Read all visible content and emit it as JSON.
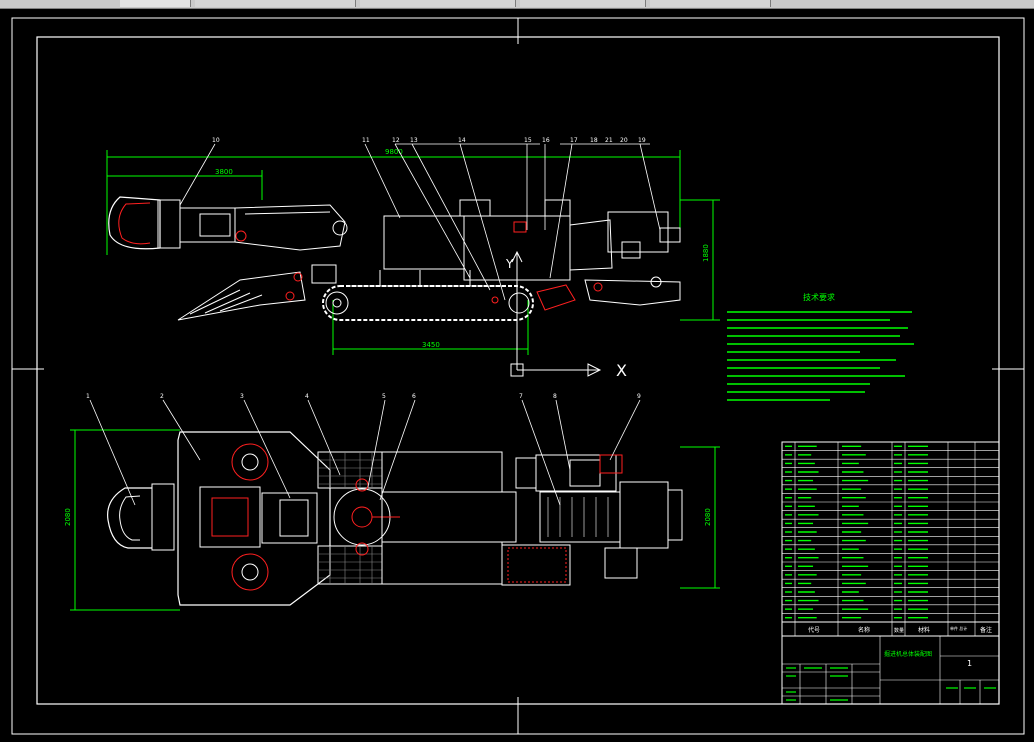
{
  "colors": {
    "background": "#000000",
    "line": "#ffffff",
    "dimension": "#00ff00",
    "highlight": "#ff2020",
    "text_green": "#00ff00"
  },
  "dimensions": {
    "overall_length": "9800",
    "boom_length": "3800",
    "track_length": "3450",
    "height": "1880",
    "plan_width_left": "2080",
    "plan_width_right": "2080"
  },
  "axis": {
    "x_label": "X",
    "y_label": "Y"
  },
  "side_balloons": [
    "10",
    "11",
    "12",
    "13",
    "14",
    "15",
    "16",
    "17",
    "18",
    "21",
    "20",
    "19"
  ],
  "plan_balloons": [
    "1",
    "2",
    "3",
    "4",
    "5",
    "6",
    "7",
    "8",
    "9"
  ],
  "tech_requirements": {
    "title": "技术要求"
  },
  "title_block": {
    "drawing_title": "掘进机总体装配图",
    "sheet": "1",
    "col_code": "代号",
    "col_name": "名称",
    "col_qty": "数量",
    "col_material": "材料",
    "col_weight": "单件 总计",
    "col_note": "备注"
  }
}
